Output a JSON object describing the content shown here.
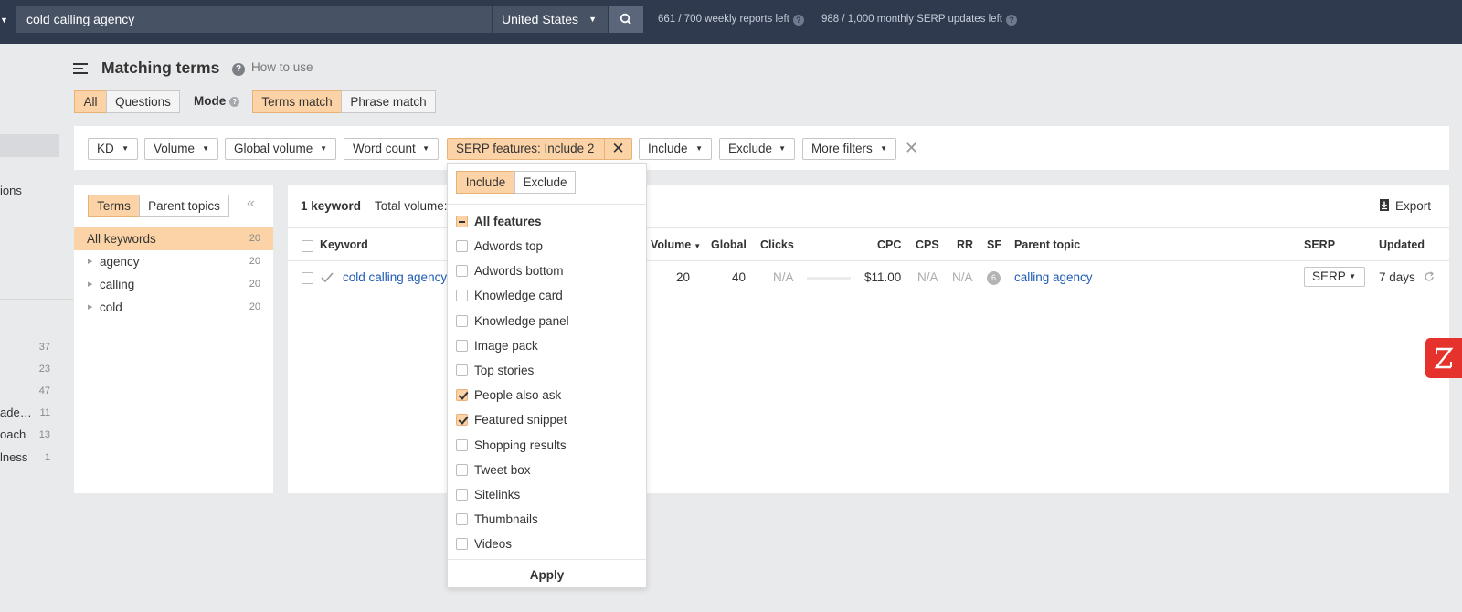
{
  "topbar": {
    "search_value": "cold calling agency",
    "country": "United States",
    "weekly_reports": "661 / 700 weekly reports left",
    "monthly_updates": "988 / 1,000 monthly SERP updates left"
  },
  "sidebar": {
    "partial_item": "ions",
    "rows": [
      {
        "label": "",
        "count": "37"
      },
      {
        "label": "",
        "count": "23"
      },
      {
        "label": "",
        "count": "47"
      },
      {
        "label": "ade…",
        "count": "11"
      },
      {
        "label": "oach",
        "count": "13"
      },
      {
        "label": "lness",
        "count": "1"
      }
    ]
  },
  "header": {
    "title": "Matching terms",
    "how_to_use": "How to use"
  },
  "scope_tabs": [
    "All",
    "Questions"
  ],
  "mode": {
    "label": "Mode",
    "options": [
      "Terms match",
      "Phrase match"
    ]
  },
  "filters": {
    "kd": "KD",
    "volume": "Volume",
    "global_volume": "Global volume",
    "word_count": "Word count",
    "serp_features": "SERP features: Include 2",
    "include": "Include",
    "exclude": "Exclude",
    "more_filters": "More filters"
  },
  "left_panel": {
    "tabs": [
      "Terms",
      "Parent topics"
    ],
    "items": [
      {
        "label": "All keywords",
        "count": "20"
      },
      {
        "label": "agency",
        "count": "20"
      },
      {
        "label": "calling",
        "count": "20"
      },
      {
        "label": "cold",
        "count": "20"
      }
    ]
  },
  "results": {
    "count": "1 keyword",
    "total_volume": "Total volume:",
    "export": "Export",
    "columns": {
      "keyword": "Keyword",
      "volume": "Volume",
      "global": "Global",
      "clicks": "Clicks",
      "cpc": "CPC",
      "cps": "CPS",
      "rr": "RR",
      "sf": "SF",
      "parent_topic": "Parent topic",
      "serp": "SERP",
      "updated": "Updated"
    },
    "row": {
      "keyword": "cold calling agency",
      "volume": "20",
      "global": "40",
      "clicks": "N/A",
      "cpc": "$11.00",
      "cps": "N/A",
      "rr": "N/A",
      "sf": "6",
      "parent_topic": "calling agency",
      "serp": "SERP",
      "updated": "7 days"
    }
  },
  "serp_dropdown": {
    "tabs": [
      "Include",
      "Exclude"
    ],
    "all_features": "All features",
    "options": [
      {
        "label": "Adwords top",
        "checked": false
      },
      {
        "label": "Adwords bottom",
        "checked": false
      },
      {
        "label": "Knowledge card",
        "checked": false
      },
      {
        "label": "Knowledge panel",
        "checked": false
      },
      {
        "label": "Image pack",
        "checked": false
      },
      {
        "label": "Top stories",
        "checked": false
      },
      {
        "label": "People also ask",
        "checked": true
      },
      {
        "label": "Featured snippet",
        "checked": true
      },
      {
        "label": "Shopping results",
        "checked": false
      },
      {
        "label": "Tweet box",
        "checked": false
      },
      {
        "label": "Sitelinks",
        "checked": false
      },
      {
        "label": "Thumbnails",
        "checked": false
      },
      {
        "label": "Videos",
        "checked": false
      }
    ],
    "apply": "Apply"
  },
  "colors": {
    "topbar": "#2f3a4f",
    "accent": "#fbd3a6",
    "link": "#1f5bb5",
    "widget": "#e5322d"
  }
}
